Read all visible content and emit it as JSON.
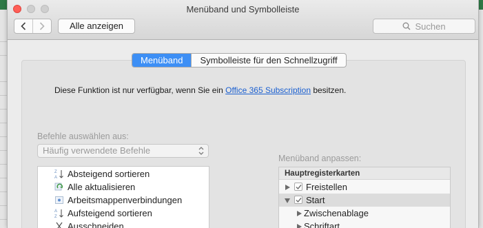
{
  "window": {
    "title": "Menüband und Symbolleiste",
    "show_all_label": "Alle anzeigen",
    "search_placeholder": "Suchen"
  },
  "tabs": [
    {
      "label": "Menüband",
      "active": true
    },
    {
      "label": "Symbolleiste für den Schnellzugriff",
      "active": false
    }
  ],
  "notice": {
    "before": "Diese Funktion ist nur verfügbar, wenn Sie ein ",
    "link": "Office 365 Subscription",
    "after": " besitzen."
  },
  "commands": {
    "label": "Befehle auswählen aus:",
    "selected": "Häufig verwendete Befehle",
    "items": [
      {
        "label": "Absteigend sortieren",
        "icon": "sort-descending-icon"
      },
      {
        "label": "Alle aktualisieren",
        "icon": "refresh-all-icon"
      },
      {
        "label": "Arbeitsmappenverbindungen",
        "icon": "workbook-connections-icon"
      },
      {
        "label": "Aufsteigend sortieren",
        "icon": "sort-ascending-icon"
      },
      {
        "label": "Ausschneiden",
        "icon": "cut-icon"
      }
    ]
  },
  "ribbon": {
    "label": "Menüband anpassen:",
    "header": "Hauptregisterkarten",
    "items": [
      {
        "label": "Freistellen",
        "checked": true,
        "expanded": false,
        "level": 0
      },
      {
        "label": "Start",
        "checked": true,
        "expanded": true,
        "level": 0,
        "selected": true
      },
      {
        "label": "Zwischenablage",
        "level": 1
      },
      {
        "label": "Schriftart",
        "level": 1
      }
    ]
  },
  "colors": {
    "accent": "#3d8ff5",
    "link": "#1a5fd0",
    "close_button": "#ff5f57"
  }
}
